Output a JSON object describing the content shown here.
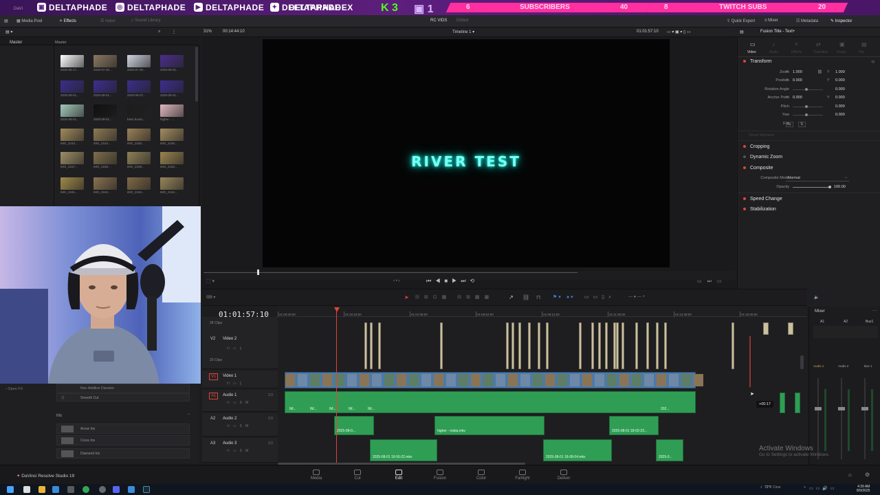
{
  "stream": {
    "handles": [
      "DELTAPHADE",
      "DELTAPHADE",
      "DELTAPHADE",
      "DELTAPHADE",
      "DELTAPHADEX"
    ],
    "kick_count": "3",
    "twitch_count": "1",
    "ticker": [
      "6",
      "SUBSCRIBERS",
      "40",
      "8",
      "TWITCH SUBS",
      "20"
    ]
  },
  "app": {
    "title": "RC VIDS",
    "status": "Edited",
    "window_label": "DaVi",
    "top_tools": [
      "Media Pool",
      "Effects",
      "Index",
      "Sound Library"
    ],
    "right_tools": [
      "Quick Export",
      "Mixer",
      "Metadata",
      "Inspector"
    ]
  },
  "viewer_bar": {
    "zoom": "31%",
    "source_tc": "00:14:44:10",
    "timeline_name": "Timeline 1",
    "record_tc": "01:01:57:10"
  },
  "media_pool": {
    "left_label": "Master",
    "right_label": "Master",
    "thumbnails": [
      {
        "label": "2025-05-17...",
        "color": "#ffffff"
      },
      {
        "label": "2025-07-30...",
        "color": "#8a7860"
      },
      {
        "label": "2025-07-30...",
        "color": "#cfd3e0"
      },
      {
        "label": "2025-08-01...",
        "color": "#4a2e8a"
      },
      {
        "label": "2025-08-01...",
        "color": "#3b2e8a"
      },
      {
        "label": "2025-08-01...",
        "color": "#3d2e8f"
      },
      {
        "label": "2025-08-07...",
        "color": "#3b2e8a"
      },
      {
        "label": "2025-08-01...",
        "color": "#3d2e8f"
      },
      {
        "label": "2025-08-01...",
        "color": "#a3c9b8"
      },
      {
        "label": "2025-08-01...",
        "color": "#101010"
      },
      {
        "label": "bass boost...",
        "color": "#1c1c1c"
      },
      {
        "label": "higher - ...",
        "color": "#e0b8c0"
      },
      {
        "label": "IMG_2153...",
        "color": "#a08a5a"
      },
      {
        "label": "IMG_2154...",
        "color": "#8e7a52"
      },
      {
        "label": "IMG_2155...",
        "color": "#9a8058"
      },
      {
        "label": "IMG_2156...",
        "color": "#a38c60"
      },
      {
        "label": "IMG_2157...",
        "color": "#9e8e66"
      },
      {
        "label": "IMG_2158...",
        "color": "#7e6e4a"
      },
      {
        "label": "IMG_2159...",
        "color": "#8e8058"
      },
      {
        "label": "IMG_2160...",
        "color": "#9a8450"
      },
      {
        "label": "IMG_2161...",
        "color": "#a08a4a"
      },
      {
        "label": "IMG_2162...",
        "color": "#8a7250"
      },
      {
        "label": "IMG_2163...",
        "color": "#7e6a46"
      },
      {
        "label": "IMG_2164...",
        "color": "#98865a"
      }
    ]
  },
  "effects": {
    "items_top": [
      "Non-Additive Dissolve",
      "Smooth Cut"
    ],
    "open_fx": "Open FX",
    "group": "Iris",
    "items": [
      "Arrow Iris",
      "Cross Iris",
      "Diamond Iris"
    ]
  },
  "viewer": {
    "title_text": "RIVER TEST",
    "playhead_fraction": 0.14
  },
  "inspector": {
    "header": "Fusion Title - Text+",
    "tabs": [
      "Video",
      "Audio",
      "Effects",
      "Transition",
      "Image",
      "File"
    ],
    "transform": {
      "label": "Transform",
      "zoom_label": "Zoom",
      "zoom_x": "1.000",
      "zoom_y": "1.000",
      "position_label": "Position",
      "pos_x": "0.000",
      "pos_y": "0.000",
      "rotation_label": "Rotation Angle",
      "rotation": "0.000",
      "anchor_label": "Anchor Point",
      "anchor_x": "0.000",
      "anchor_y": "0.000",
      "pitch_label": "Pitch",
      "pitch": "0.000",
      "yaw_label": "Yaw",
      "yaw": "0.000",
      "flip_label": "Flip"
    },
    "smart_reframe": "Smart Reframe",
    "cropping": "Cropping",
    "dynamic_zoom": "Dynamic Zoom",
    "composite": "Composite",
    "composite_mode_label": "Composite Mode",
    "composite_mode": "Normal",
    "opacity_label": "Opacity",
    "opacity": "100.00",
    "speed_change": "Speed Change",
    "stabilization": "Stabilization"
  },
  "timeline": {
    "timecode": "01:01:57:10",
    "ruler": [
      "01:00:00:00",
      "01:02:18:00",
      "01:04:36:00",
      "01:06:54:00",
      "01:09:12:00",
      "01:11:30:00",
      "01:13:48:00",
      "01:16:06:00"
    ],
    "tracks": [
      {
        "id": "V2",
        "name": "Video 2",
        "clips": "28 Clips"
      },
      {
        "id": "V1",
        "name": "Video 1",
        "clips": "29 Clips"
      },
      {
        "id": "A1",
        "name": "Audio 1",
        "level": "2.0"
      },
      {
        "id": "A2",
        "name": "Audio 2",
        "level": "2.0"
      },
      {
        "id": "A3",
        "name": "Audio 3",
        "level": "2.0"
      }
    ],
    "a1_labels": [
      "IM...",
      "IM...",
      "IM...",
      "IM...",
      "IM...",
      "202..."
    ],
    "a2_clips": [
      "2025-08-0...",
      "higher - nokia.mkv",
      "2025-08-01 18-02-23..."
    ],
    "a3_clips": [
      "2025-08-01 19-50-22.mkv",
      "2025-08-01 18-08-04.mkv",
      "2025-0..."
    ],
    "drag_tooltip": "+00:17"
  },
  "mixer": {
    "title": "Mixer",
    "channels": [
      "A1",
      "A2",
      "Bus1"
    ],
    "strips": [
      "Audio 1",
      "Audio 2",
      "Bus 1"
    ]
  },
  "pages": [
    "Media",
    "Cut",
    "Edit",
    "Fusion",
    "Color",
    "Fairlight",
    "Deliver"
  ],
  "active_page": "Edit",
  "brand": "DaVinci Resolve Studio 19",
  "watermark": {
    "line1": "Activate Windows",
    "line2": "Go to Settings to activate Windows."
  },
  "tray": {
    "weather": "72°F",
    "weather_sub": "Clear",
    "time": "4:39 AM",
    "date": "8/9/2025"
  },
  "colors": {
    "accent_red": "#e0443a",
    "clip_audio": "#2f9e54",
    "clip_video": "#4d7aa6",
    "title_glow": "#1fffe8"
  }
}
